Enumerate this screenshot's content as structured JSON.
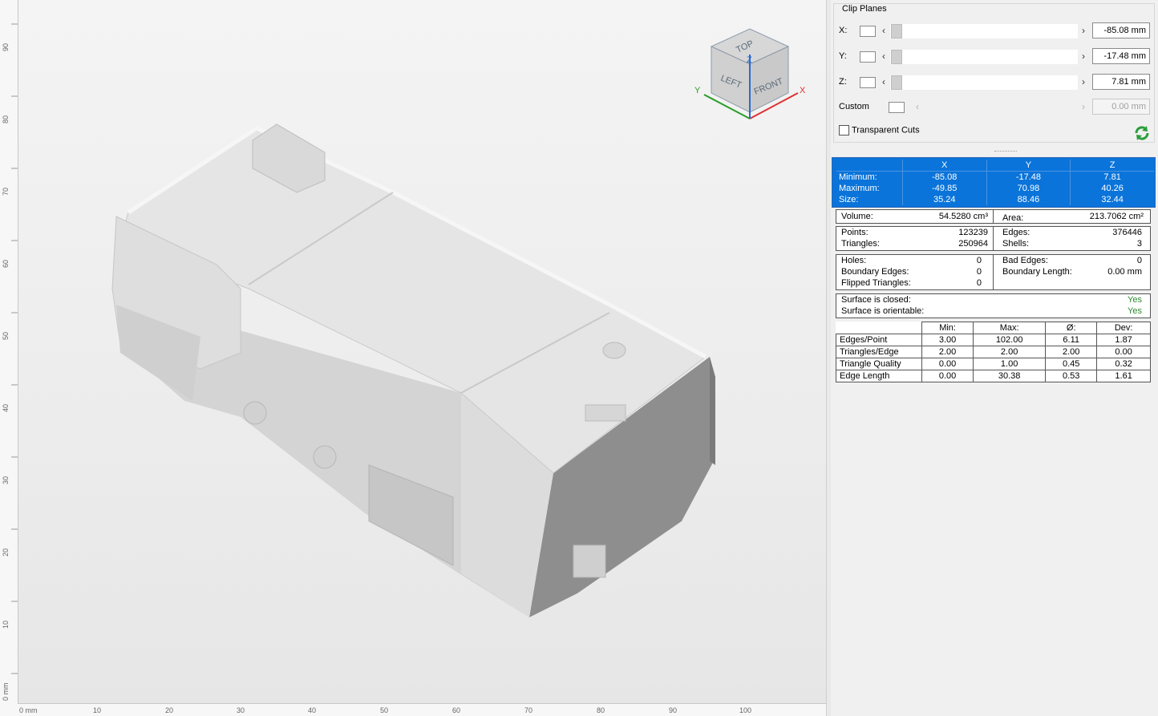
{
  "viewport": {
    "ruler_left_labels": [
      "90",
      "80",
      "70",
      "60",
      "50",
      "40",
      "30",
      "20",
      "10",
      "0 mm"
    ],
    "ruler_bottom_labels": [
      "0 mm",
      "10",
      "20",
      "30",
      "40",
      "50",
      "60",
      "70",
      "80",
      "90",
      "100"
    ],
    "view_cube": {
      "top": "TOP",
      "left": "LEFT",
      "front": "FRONT",
      "axis_x": "X",
      "axis_y": "Y",
      "axis_z": "Z"
    }
  },
  "clip_planes": {
    "title": "Clip Planes",
    "rows": [
      {
        "label": "X:",
        "value": "-85.08 mm"
      },
      {
        "label": "Y:",
        "value": "-17.48 mm"
      },
      {
        "label": "Z:",
        "value": "7.81 mm"
      },
      {
        "label": "Custom",
        "value": "0.00 mm"
      }
    ],
    "transparent_cuts": "Transparent Cuts"
  },
  "bounding_box": {
    "columns": [
      "X",
      "Y",
      "Z"
    ],
    "rows": [
      {
        "label": "Minimum:",
        "x": "-85.08",
        "y": "-17.48",
        "z": "7.81"
      },
      {
        "label": "Maximum:",
        "x": "-49.85",
        "y": "70.98",
        "z": "40.26"
      },
      {
        "label": "Size:",
        "x": "35.24",
        "y": "88.46",
        "z": "32.44"
      }
    ]
  },
  "volume": {
    "label": "Volume:",
    "value": "54.5280 cm³"
  },
  "area": {
    "label": "Area:",
    "value": "213.7062 cm²"
  },
  "points": {
    "label": "Points:",
    "value": "123239"
  },
  "edges": {
    "label": "Edges:",
    "value": "376446"
  },
  "triangles": {
    "label": "Triangles:",
    "value": "250964"
  },
  "shells": {
    "label": "Shells:",
    "value": "3"
  },
  "holes": {
    "label": "Holes:",
    "value": "0"
  },
  "bad_edges": {
    "label": "Bad Edges:",
    "value": "0"
  },
  "boundary_edges": {
    "label": "Boundary Edges:",
    "value": "0"
  },
  "boundary_length": {
    "label": "Boundary Length:",
    "value": "0.00 mm"
  },
  "flipped_triangles": {
    "label": "Flipped Triangles:",
    "value": "0"
  },
  "surface_closed": {
    "label": "Surface is closed:",
    "value": "Yes"
  },
  "surface_orientable": {
    "label": "Surface is orientable:",
    "value": "Yes"
  },
  "quality": {
    "columns": [
      "Min:",
      "Max:",
      "Ø:",
      "Dev:"
    ],
    "rows": [
      {
        "label": "Edges/Point",
        "values": [
          "3.00",
          "102.00",
          "6.11",
          "1.87"
        ]
      },
      {
        "label": "Triangles/Edge",
        "values": [
          "2.00",
          "2.00",
          "2.00",
          "0.00"
        ]
      },
      {
        "label": "Triangle Quality",
        "values": [
          "0.00",
          "1.00",
          "0.45",
          "0.32"
        ]
      },
      {
        "label": "Edge Length",
        "values": [
          "0.00",
          "30.38",
          "0.53",
          "1.61"
        ]
      }
    ]
  }
}
